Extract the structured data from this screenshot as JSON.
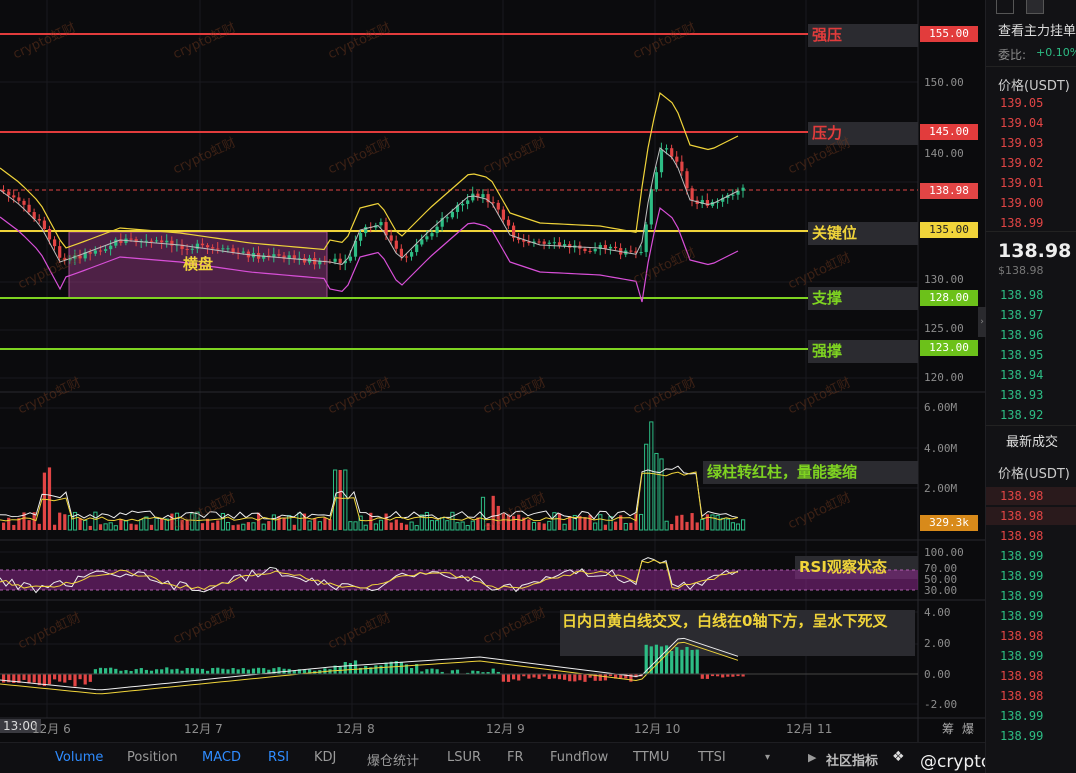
{
  "annotations": {
    "strong_resist": "强压",
    "resist": "压力",
    "key_level": "关键位",
    "consolidation": "横盘",
    "support": "支撑",
    "strong_support": "强撑",
    "volume_note": "绿柱转红柱，量能萎缩",
    "rsi_note": "RSI观察状态",
    "macd_note": "日内日黄白线交叉，白线在0轴下方，呈水下死叉"
  },
  "price_levels": {
    "strong_resist": "155.00",
    "resist": "145.00",
    "current": "138.98",
    "key_level": "135.00",
    "support": "128.00",
    "strong_support": "123.00"
  },
  "price_axis": [
    "150.00",
    "140.00",
    "130.00",
    "125.00",
    "120.00"
  ],
  "volume_axis": [
    "6.00M",
    "4.00M",
    "2.00M"
  ],
  "volume_current": "329.3k",
  "rsi_axis": [
    "100.00",
    "70.00",
    "50.00",
    "30.00"
  ],
  "macd_axis": [
    "4.00",
    "2.00",
    "0.00",
    "-2.00"
  ],
  "dates": {
    "time_tag": "13:00",
    "d6": "12月 6",
    "d7": "12月 7",
    "d8": "12月 8",
    "d9": "12月 9",
    "d10": "12月 10",
    "d11": "12月 11"
  },
  "toolbar": {
    "volume": "Volume",
    "position": "Position",
    "macd": "MACD",
    "rsi": "RSI",
    "kdj": "KDJ",
    "liq": "爆仓统计",
    "lsur": "LSUR",
    "fr": "FR",
    "fundflow": "Fundflow",
    "ttmu": "TTMU",
    "ttsi": "TTSI",
    "community": "社区指标",
    "chip1": "筹",
    "chip2": "爆",
    "handle": "@crypto虹财"
  },
  "sidebar": {
    "title": "查看主力挂单",
    "ratio_label": "委比:",
    "ratio_value": "+0.10%",
    "price_header": "价格(USDT)",
    "asks": [
      "139.05",
      "139.04",
      "139.03",
      "139.02",
      "139.01",
      "139.00",
      "138.99"
    ],
    "mid_price": "138.98",
    "mid_usd": "$138.98",
    "bids": [
      "138.98",
      "138.97",
      "138.96",
      "138.95",
      "138.94",
      "138.93",
      "138.92"
    ],
    "trades_title": "最新成交",
    "trades_header": "价格(USDT)",
    "trades": [
      {
        "p": "138.98",
        "s": "red"
      },
      {
        "p": "138.98",
        "s": "red"
      },
      {
        "p": "138.98",
        "s": "red"
      },
      {
        "p": "138.99",
        "s": "green"
      },
      {
        "p": "138.99",
        "s": "green"
      },
      {
        "p": "138.99",
        "s": "green"
      },
      {
        "p": "138.99",
        "s": "green"
      },
      {
        "p": "138.98",
        "s": "red"
      },
      {
        "p": "138.99",
        "s": "green"
      },
      {
        "p": "138.98",
        "s": "red"
      },
      {
        "p": "138.98",
        "s": "red"
      },
      {
        "p": "138.99",
        "s": "green"
      },
      {
        "p": "138.99",
        "s": "green"
      }
    ]
  },
  "watermark": "crypto虹财",
  "colors": {
    "up": "#2dbd85",
    "down": "#e24545",
    "yellow": "#f0d43a",
    "support": "#7ed321"
  }
}
